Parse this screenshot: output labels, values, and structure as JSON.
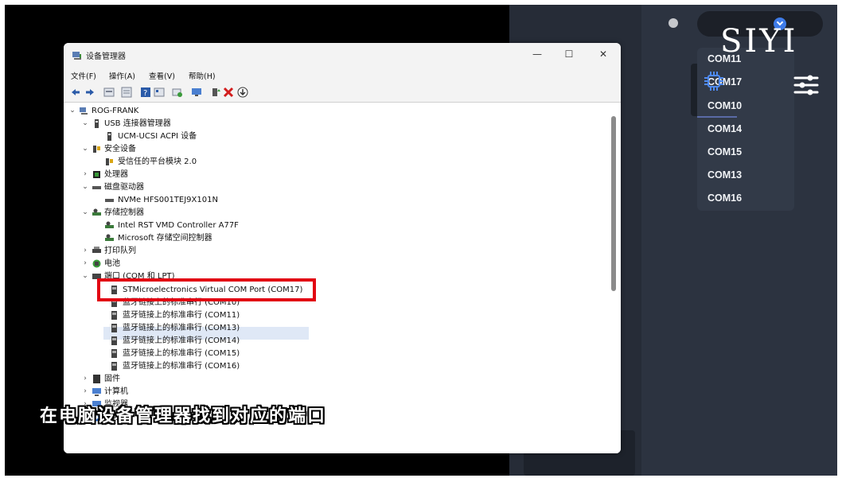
{
  "window": {
    "title": "设备管理器",
    "minimize": "—",
    "maximize": "☐",
    "close": "✕"
  },
  "menu": [
    "文件(F)",
    "操作(A)",
    "查看(V)",
    "帮助(H)"
  ],
  "tree": {
    "root": "ROG-FRANK",
    "usb": "USB 连接器管理器",
    "usb_child": "UCM-UCSI ACPI 设备",
    "security": "安全设备",
    "security_child": "受信任的平台模块 2.0",
    "processor": "处理器",
    "disk": "磁盘驱动器",
    "disk_child": "NVMe HFS001TEJ9X101N",
    "storage": "存储控制器",
    "storage_child1": "Intel RST VMD Controller A77F",
    "storage_child2": "Microsoft 存储空间控制器",
    "print": "打印队列",
    "battery": "电池",
    "ports": "端口 (COM 和 LPT)",
    "port_selected": "STMicroelectronics Virtual COM Port (COM17)",
    "bt_ports": [
      "蓝牙链接上的标准串行 (COM10)",
      "蓝牙链接上的标准串行 (COM11)",
      "蓝牙链接上的标准串行 (COM13)",
      "蓝牙链接上的标准串行 (COM14)",
      "蓝牙链接上的标准串行 (COM15)",
      "蓝牙链接上的标准串行 (COM16)"
    ],
    "firmware": "固件",
    "computer": "计算机",
    "monitor": "监视器",
    "bluetooth": "蓝牙"
  },
  "right_app": {
    "logo": "SIYI",
    "com_list": [
      "COM11",
      "COM17",
      "COM10",
      "COM14",
      "COM15",
      "COM13",
      "COM16"
    ]
  },
  "caption": "在电脑设备管理器找到对应的端口",
  "colors": {
    "highlight_border": "#e20613",
    "app_bg": "#262c37",
    "dropdown_bg": "#323a48",
    "accent_blue": "#3e7be8"
  }
}
